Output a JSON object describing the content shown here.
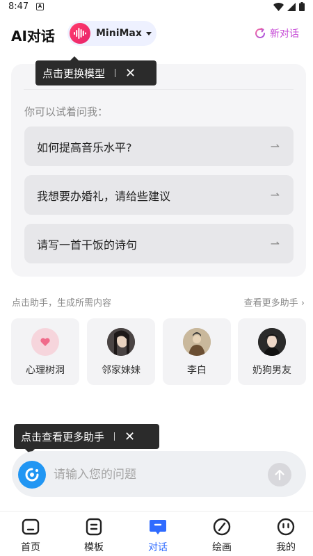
{
  "status": {
    "time": "8:47",
    "notif_glyph": "A"
  },
  "header": {
    "title": "AI对话",
    "model_name": "MiniMax",
    "new_chat_label": "新对话"
  },
  "tooltips": {
    "model": {
      "text": "点击更换模型",
      "close": "✕"
    },
    "assistant": {
      "text": "点击查看更多助手",
      "close": "✕"
    }
  },
  "suggestions": {
    "heading": "你可以试着问我：",
    "items": [
      {
        "text": "如何提高音乐水平?"
      },
      {
        "text": "我想要办婚礼，请给些建议"
      },
      {
        "text": "请写一首干饭的诗句"
      }
    ]
  },
  "assistants": {
    "hint": "点击助手，生成所需内容",
    "more": "查看更多助手",
    "items": [
      {
        "name": "心理树洞"
      },
      {
        "name": "邻家妹妹"
      },
      {
        "name": "李白"
      },
      {
        "name": "奶狗男友"
      }
    ]
  },
  "input": {
    "placeholder": "请输入您的问题"
  },
  "nav": {
    "items": [
      {
        "label": "首页",
        "icon": "home-icon"
      },
      {
        "label": "模板",
        "icon": "template-icon"
      },
      {
        "label": "对话",
        "icon": "chat-icon"
      },
      {
        "label": "绘画",
        "icon": "paint-icon"
      },
      {
        "label": "我的",
        "icon": "profile-icon"
      }
    ],
    "active": "对话"
  },
  "colors": {
    "accent": "#2f6bff",
    "new_chat": "#c64bd6",
    "model_avatar": "#e8246b",
    "tooltip_bg": "#2b2b2b"
  }
}
